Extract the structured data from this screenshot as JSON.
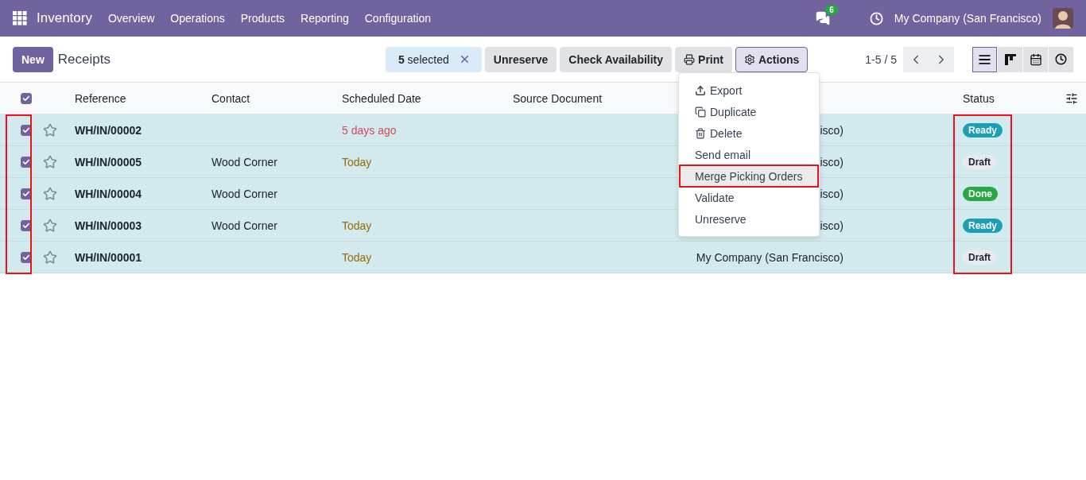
{
  "navbar": {
    "app": "Inventory",
    "menus": [
      "Overview",
      "Operations",
      "Products",
      "Reporting",
      "Configuration"
    ],
    "messages_badge": "6",
    "company": "My Company (San Francisco)"
  },
  "control_panel": {
    "new_button": "New",
    "title": "Receipts",
    "selection": "**5** selected",
    "buttons": [
      {
        "label": "Unreserve",
        "kind": "plain",
        "active": false
      },
      {
        "label": "Check Availability",
        "kind": "plain",
        "active": false
      },
      {
        "label": "Print",
        "kind": "print",
        "active": false
      },
      {
        "label": "Actions",
        "kind": "gear",
        "active": true
      }
    ],
    "pager": "1-5 / 5",
    "views": [
      {
        "kind": "list",
        "selected": true
      },
      {
        "kind": "kanban",
        "selected": false
      },
      {
        "kind": "calendar",
        "selected": false
      },
      {
        "kind": "activity",
        "selected": false
      }
    ]
  },
  "table": {
    "select_all": {
      "checked": true
    },
    "columns": [
      "Reference",
      "Contact",
      "Scheduled Date",
      "Source Document",
      "Status"
    ],
    "rows": [
      {
        "checked": true,
        "starred": false,
        "reference": "WH/IN/00002",
        "contact": "",
        "scheduled_date": {
          "text": "5 days ago",
          "color": "#d44c59"
        },
        "column_5": "isco)",
        "status": {
          "label": "Ready",
          "color": "#1b9fb5"
        }
      },
      {
        "checked": true,
        "starred": false,
        "reference": "WH/IN/00005",
        "contact": "Wood Corner",
        "scheduled_date": {
          "text": "Today",
          "color": "#9a6b01"
        },
        "column_5": "isco)",
        "status": {
          "label": "Draft",
          "color": "#e7e9ed"
        }
      },
      {
        "checked": true,
        "starred": false,
        "reference": "WH/IN/00004",
        "contact": "Wood Corner",
        "column_5": "isco)",
        "status": {
          "label": "Done",
          "color": "#28a745"
        }
      },
      {
        "checked": true,
        "starred": false,
        "reference": "WH/IN/00003",
        "contact": "Wood Corner",
        "scheduled_date": {
          "text": "Today",
          "color": "#9a6b01"
        },
        "column_5": "isco)",
        "status": {
          "label": "Ready",
          "color": "#1b9fb5"
        }
      },
      {
        "checked": true,
        "starred": false,
        "reference": "WH/IN/00001",
        "contact": "",
        "scheduled_date": {
          "text": "Today",
          "color": "#9a6b01"
        },
        "column_5": "My Company (San Francisco)",
        "status": {
          "label": "Draft",
          "color": "#e7e9ed"
        }
      }
    ]
  },
  "actions_menu": {
    "items": [
      {
        "label": "Export",
        "kind": "export",
        "highlighted": false
      },
      {
        "label": "Duplicate",
        "kind": "duplicate",
        "highlighted": false
      },
      {
        "label": "Delete",
        "kind": "delete",
        "highlighted": false
      },
      {
        "label": "Send email",
        "kind": "plain",
        "highlighted": false
      },
      {
        "label": "Merge Picking Orders",
        "kind": "plain",
        "highlighted": true
      },
      {
        "label": "Validate",
        "kind": "plain",
        "highlighted": false
      },
      {
        "label": "Unreserve",
        "kind": "plain",
        "highlighted": false
      }
    ]
  },
  "annotations": {
    "checkbox_column": true,
    "status_column": true
  }
}
